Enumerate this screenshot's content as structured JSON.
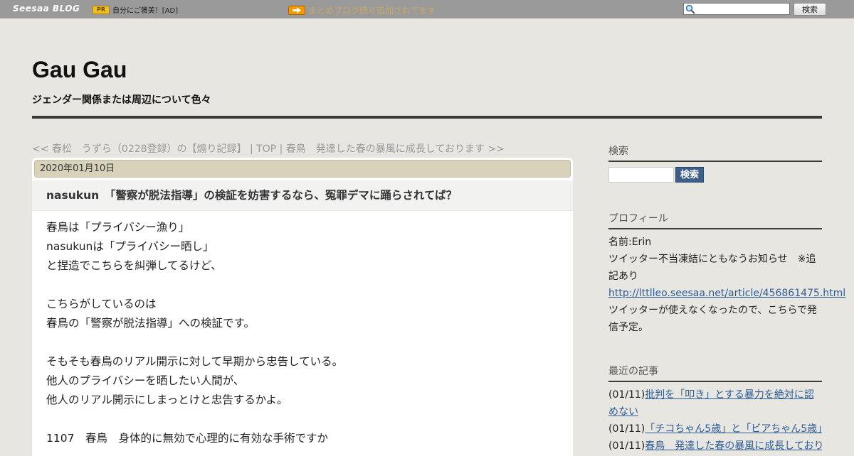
{
  "topbar": {
    "logo": "Seesaa BLOG",
    "pr_badge": "PR",
    "pr_text": "自分にご褒美！[AD]",
    "notice": "まとめブログ続々追加されてます",
    "search_button": "検索"
  },
  "header": {
    "title": "Gau Gau",
    "description": "ジェンダー関係または周辺について色々"
  },
  "nav": {
    "prev": "<< 春松　うずら（0228登録）の【煽り記録】",
    "sep1": " | ",
    "top": "TOP",
    "sep2": " | ",
    "next": "春鳥　発達した春の暴風に成長しております >>"
  },
  "entry": {
    "date": "2020年01月10日",
    "title": "nasukun　「警察が脱法指導」の検証を妨害するなら、冤罪デマに踊らされてば？",
    "lines": [
      "春鳥は「プライバシー漁り」",
      "nasukunは「プライバシー晒し」",
      "と捏造でこちらを糾弾してるけど、",
      "",
      "こちらがしているのは",
      "春鳥の「警察が脱法指導」への検証です。",
      "",
      "そもそも春鳥のリアル開示に対して早期から忠告している。",
      "他人のプライバシーを晒したい人間が、",
      "他人のリアル開示にしまっとけと忠告するかよ。",
      "",
      "1107　春鳥　身体的に無効で心理的に有効な手術ですか"
    ]
  },
  "sidebar": {
    "search_heading": "検索",
    "search_button": "検索",
    "profile_heading": "プロフィール",
    "profile_name": "名前:Erin",
    "profile_text1": "ツイッター不当凍結にともなうお知らせ　※追記あり",
    "profile_link": "http://lttlleo.seesaa.net/article/456861475.html",
    "profile_text2": "ツイッターが使えなくなったので、こちらで発信予定。",
    "recent_heading": "最近の記事",
    "recent": [
      {
        "date": "(01/11)",
        "title": "批判を「叩き」とする暴力を絶対に認めない"
      },
      {
        "date": "(01/11)",
        "title": "「チコちゃん5歳」と「ビアちゃん5歳」"
      },
      {
        "date": "(01/11)",
        "title": "春鳥　発達した春の暴風に成長しております"
      }
    ]
  }
}
